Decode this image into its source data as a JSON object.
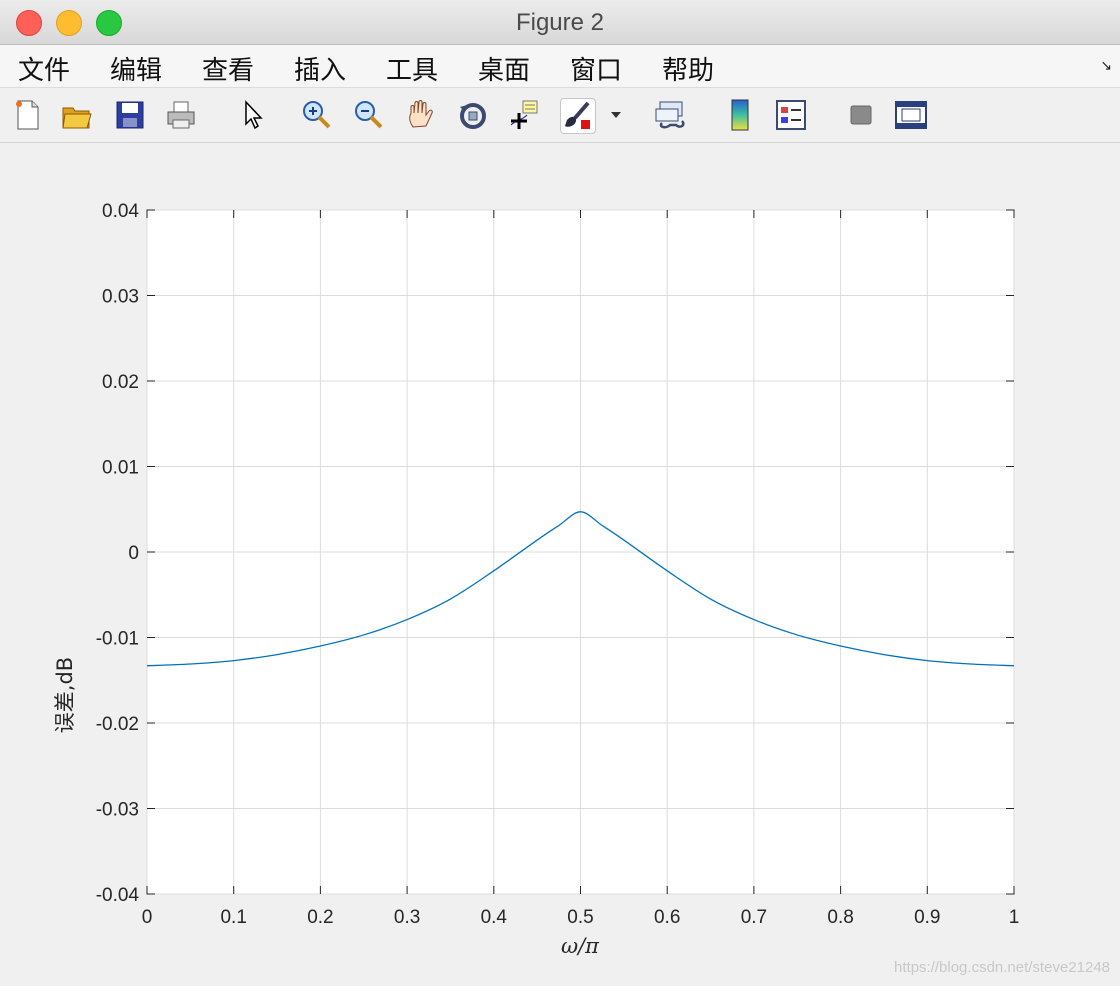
{
  "window": {
    "title": "Figure 2"
  },
  "menu": [
    "文件",
    "编辑",
    "查看",
    "插入",
    "工具",
    "桌面",
    "窗口",
    "帮助"
  ],
  "toolbar_icons": [
    "new-figure-icon",
    "open-file-icon",
    "save-icon",
    "print-icon",
    "select-pointer-icon",
    "zoom-in-icon",
    "zoom-out-icon",
    "pan-hand-icon",
    "rotate-3d-icon",
    "data-cursor-icon",
    "brush-icon",
    "brush-dropdown-icon",
    "link-plot-icon",
    "colorbar-icon",
    "legend-icon",
    "hide-plot-tools-icon",
    "show-plot-tools-icon"
  ],
  "colors": {
    "line": "#0072bd",
    "grid": "#dcdcdc",
    "axes": "#262626"
  },
  "watermark": "https://blog.csdn.net/steve21248",
  "chart_data": {
    "type": "line",
    "xlabel": "ω/π",
    "ylabel": "误差,dB",
    "xlim": [
      0,
      1
    ],
    "ylim": [
      -0.04,
      0.04
    ],
    "xticks": [
      "0",
      "0.1",
      "0.2",
      "0.3",
      "0.4",
      "0.5",
      "0.6",
      "0.7",
      "0.8",
      "0.9",
      "1"
    ],
    "yticks": [
      "0.04",
      "0.03",
      "0.02",
      "0.01",
      "0",
      "-0.01",
      "-0.02",
      "-0.03",
      "-0.04"
    ],
    "grid": true,
    "series": [
      {
        "x": [
          0,
          0.05,
          0.1,
          0.15,
          0.2,
          0.25,
          0.3,
          0.35,
          0.4,
          0.45,
          0.475,
          0.5,
          0.525,
          0.55,
          0.6,
          0.65,
          0.7,
          0.75,
          0.8,
          0.85,
          0.9,
          0.95,
          1.0
        ],
        "y": [
          -0.0133,
          -0.0131,
          -0.0127,
          -0.012,
          -0.011,
          -0.0097,
          -0.0079,
          -0.0055,
          -0.0022,
          0.0014,
          0.0031,
          0.0047,
          0.0031,
          0.0014,
          -0.0022,
          -0.0055,
          -0.0079,
          -0.0097,
          -0.011,
          -0.012,
          -0.0127,
          -0.0131,
          -0.0133
        ]
      }
    ]
  }
}
